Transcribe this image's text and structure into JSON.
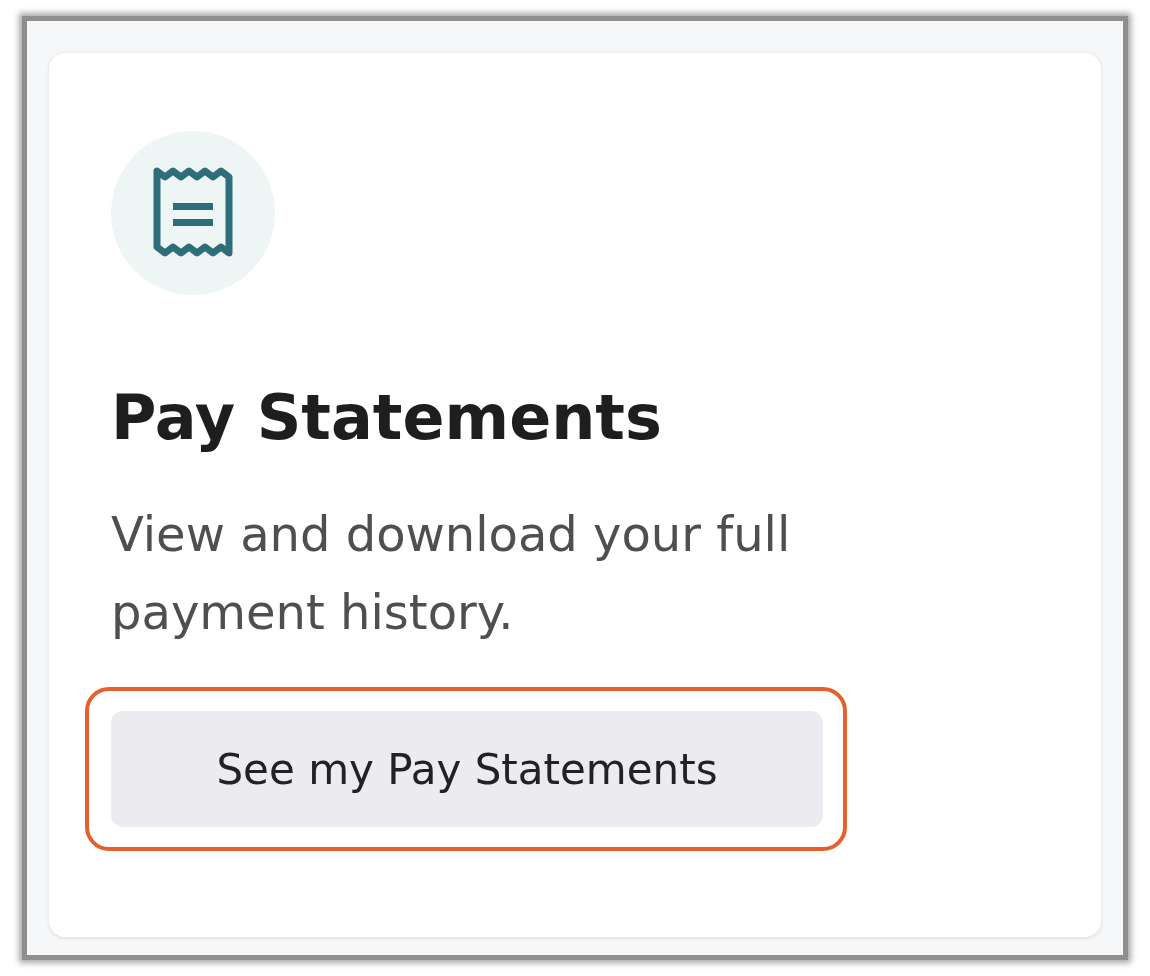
{
  "card": {
    "title": "Pay Statements",
    "description": "View and download your full payment history.",
    "button": {
      "label": "See my Pay Statements",
      "highlighted": true
    }
  }
}
